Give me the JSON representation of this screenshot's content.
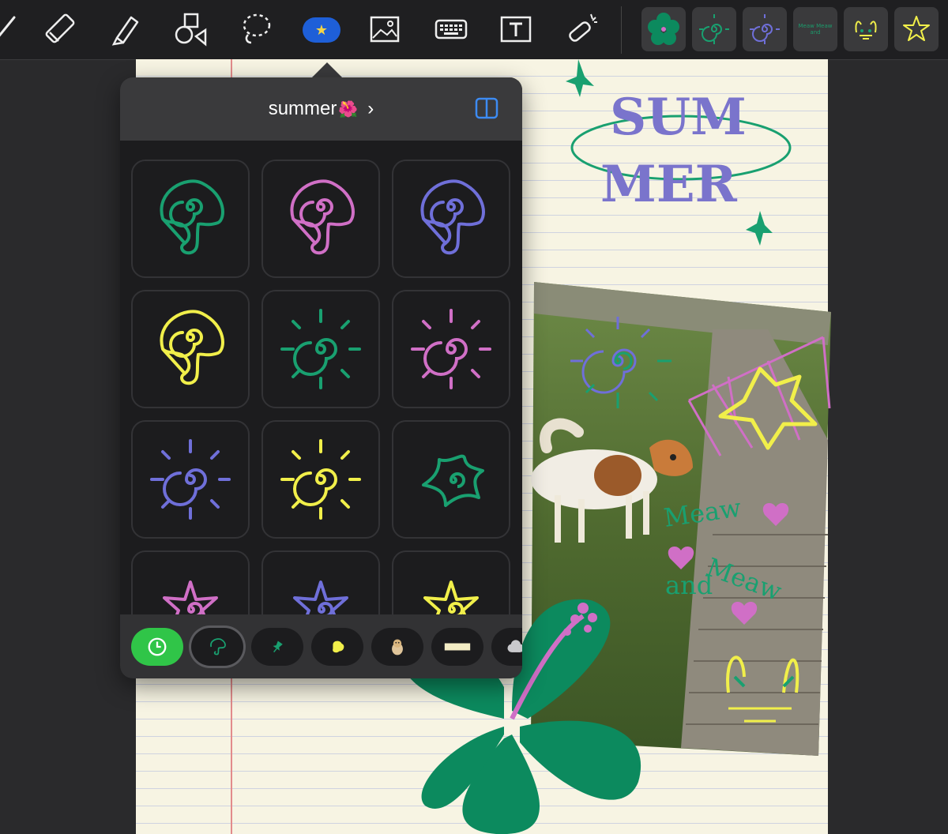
{
  "toolbar": {
    "tools": [
      "pen-tool",
      "eraser-tool",
      "highlighter-tool",
      "shapes-tool",
      "lasso-tool",
      "sticker-tool",
      "image-tool",
      "keyboard-tool",
      "text-tool",
      "laser-pointer-tool"
    ],
    "active_tool": "sticker-tool",
    "recent_stickers": [
      "hibiscus-sticker",
      "green-sun-sticker",
      "purple-sun-sticker",
      "meaw-text-sticker",
      "cat-face-sticker",
      "yellow-star-sticker"
    ],
    "meaw_sticker_text": "Meaw Meaw and"
  },
  "popover": {
    "title": "summer",
    "title_emoji": "🌺",
    "stickers": [
      {
        "name": "green-mushroom",
        "color": "#19a070"
      },
      {
        "name": "pink-mushroom",
        "color": "#d06fc6"
      },
      {
        "name": "purple-mushroom",
        "color": "#6f6fd9"
      },
      {
        "name": "yellow-mushroom",
        "color": "#f1ef4a"
      },
      {
        "name": "green-sun",
        "color": "#19a070"
      },
      {
        "name": "pink-sun",
        "color": "#d06fc6"
      },
      {
        "name": "purple-sun",
        "color": "#6f6fd9"
      },
      {
        "name": "yellow-sun",
        "color": "#f1ef4a"
      },
      {
        "name": "green-star",
        "color": "#19a070"
      },
      {
        "name": "pink-star",
        "color": "#d06fc6"
      },
      {
        "name": "purple-star",
        "color": "#6f6fd9"
      },
      {
        "name": "yellow-star",
        "color": "#f1ef4a"
      }
    ],
    "tabs": [
      "recents",
      "summer-doodles",
      "pin",
      "yellow-blob",
      "dog-photo",
      "tape",
      "cloud"
    ],
    "selected_tab": "summer-doodles"
  },
  "canvas": {
    "doodle_text_line1": "SUM",
    "doodle_text_line2": "MER",
    "photo_annotations": [
      "Meaw",
      "Meaw",
      "and"
    ]
  },
  "colors": {
    "accent_blue": "#1e5fd8",
    "recents_green": "#30c548",
    "hibiscus_green": "#0c8a5e"
  }
}
